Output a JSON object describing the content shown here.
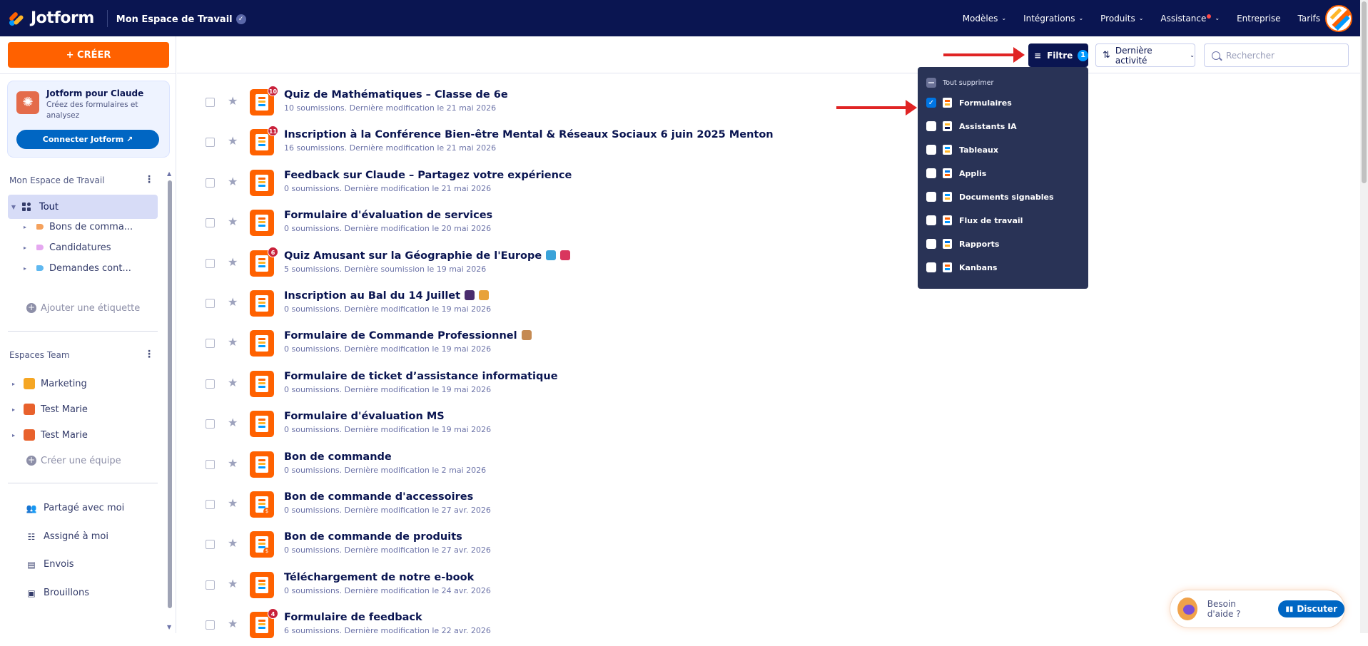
{
  "nav": {
    "brand": "Jotform",
    "workspace_title": "Mon Espace de Travail",
    "items": [
      {
        "label": "Modèles",
        "chevron": true
      },
      {
        "label": "Intégrations",
        "chevron": true
      },
      {
        "label": "Produits",
        "chevron": true
      },
      {
        "label": "Assistance",
        "chevron": true,
        "dot": true
      },
      {
        "label": "Entreprise",
        "chevron": false
      },
      {
        "label": "Tarifs",
        "chevron": false
      }
    ]
  },
  "sidebar": {
    "create_label": "+ CRÉER",
    "promo": {
      "title": "Jotform pour Claude",
      "subtitle": "Créez des formulaires et analysez",
      "button": "Connecter Jotform ↗"
    },
    "workspace_label": "Mon Espace de Travail",
    "all_label": "Tout",
    "labels": [
      {
        "name": "Bons de comma...",
        "color": "#f5a25d"
      },
      {
        "name": "Candidatures",
        "color": "#e5a8f0"
      },
      {
        "name": "Demandes cont...",
        "color": "#5fb8f0"
      }
    ],
    "add_label": "Ajouter une étiquette",
    "teams_label": "Espaces Team",
    "teams": [
      "Marketing",
      "Test Marie",
      "Test Marie"
    ],
    "create_team": "Créer une équipe",
    "bottom": [
      {
        "label": "Partagé avec moi",
        "icon": "shared-icon"
      },
      {
        "label": "Assigné à moi",
        "icon": "assigned-icon"
      },
      {
        "label": "Envois",
        "icon": "inbox-icon"
      },
      {
        "label": "Brouillons",
        "icon": "drafts-icon"
      }
    ]
  },
  "toolbar": {
    "filter_label": "Filtre",
    "filter_count": "1",
    "sort_label": "Dernière activité",
    "search_placeholder": "Rechercher"
  },
  "filter_menu": {
    "clear_all": "Tout supprimer",
    "options": [
      {
        "label": "Formulaires",
        "checked": true
      },
      {
        "label": "Assistants IA",
        "checked": false
      },
      {
        "label": "Tableaux",
        "checked": false
      },
      {
        "label": "Applis",
        "checked": false
      },
      {
        "label": "Documents signables",
        "checked": false
      },
      {
        "label": "Flux de travail",
        "checked": false
      },
      {
        "label": "Rapports",
        "checked": false
      },
      {
        "label": "Kanbans",
        "checked": false
      }
    ]
  },
  "forms": [
    {
      "title": "Quiz de Mathématiques – Classe de 6e",
      "meta": "10 soumissions. Dernière modification le 21 mai 2026",
      "badge": "10"
    },
    {
      "title": "Inscription à la Conférence Bien-être Mental & Réseaux Sociaux 6 juin 2025 Menton",
      "meta": "16 soumissions. Dernière modification le 21 mai 2026",
      "badge": "11"
    },
    {
      "title": "Feedback sur Claude – Partagez votre expérience",
      "meta": "0 soumissions. Dernière modification le 21 mai 2026",
      "badge": ""
    },
    {
      "title": "Formulaire d'évaluation de services",
      "meta": "0 soumissions. Dernière modification le 20 mai 2026",
      "badge": ""
    },
    {
      "title": "Quiz Amusant sur la Géographie de l'Europe",
      "meta": "5 soumissions. Dernière soumission le 19 mai 2026",
      "badge": "6",
      "emojis": [
        "#3aa3d9",
        "#d9365e"
      ]
    },
    {
      "title": "Inscription au Bal du 14 Juillet",
      "meta": "0 soumissions. Dernière modification le 19 mai 2026",
      "badge": "",
      "emojis": [
        "#4a2c6e",
        "#e8a23a"
      ]
    },
    {
      "title": "Formulaire de Commande Professionnel",
      "meta": "0 soumissions. Dernière modification le 19 mai 2026",
      "badge": "",
      "emojis": [
        "#c58a52"
      ]
    },
    {
      "title": "Formulaire de ticket d’assistance informatique",
      "meta": "0 soumissions. Dernière modification le 19 mai 2026",
      "badge": ""
    },
    {
      "title": "Formulaire d'évaluation MS",
      "meta": "0 soumissions. Dernière modification le 19 mai 2026",
      "badge": ""
    },
    {
      "title": "Bon de commande",
      "meta": "0 soumissions. Dernière modification le 2 mai 2026",
      "badge": ""
    },
    {
      "title": "Bon de commande d'accessoires",
      "meta": "0 soumissions. Dernière modification le 27 avr. 2026",
      "badge": "",
      "payment": true
    },
    {
      "title": "Bon de commande de produits",
      "meta": "0 soumissions. Dernière modification le 27 avr. 2026",
      "badge": "",
      "payment": true
    },
    {
      "title": "Téléchargement de notre e-book",
      "meta": "0 soumissions. Dernière modification le 24 avr. 2026",
      "badge": ""
    },
    {
      "title": "Formulaire de feedback",
      "meta": "6 soumissions. Dernière modification le 22 avr. 2026",
      "badge": "4"
    }
  ],
  "chat": {
    "prompt": "Besoin d'aide ?",
    "button": "Discuter"
  }
}
